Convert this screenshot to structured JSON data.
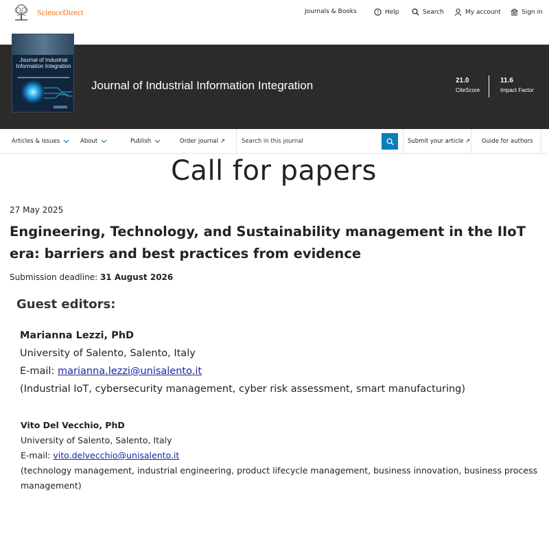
{
  "header": {
    "brand": "ScienceDirect",
    "nav": [
      {
        "label": "Journals & Books",
        "icon": ""
      },
      {
        "label": "Help",
        "icon": "help-icon"
      },
      {
        "label": "Search",
        "icon": "search-icon"
      },
      {
        "label": "My account",
        "icon": "user-icon"
      },
      {
        "label": "Sign in",
        "icon": "institution-icon"
      }
    ],
    "brand_color": "#e9711c"
  },
  "banner": {
    "cover_title": "Journal of Industrial Information Integration",
    "journal_title": "Journal of Industrial Information Integration",
    "metrics": [
      {
        "value": "21.0",
        "label": "CiteScore"
      },
      {
        "value": "11.6",
        "label": "Impact Factor"
      }
    ],
    "background": "#2b2b2b"
  },
  "journal_nav": {
    "articles": "Articles & Issues",
    "about": "About",
    "publish": "Publish",
    "order": "Order journal ↗",
    "search_placeholder": "Search in this journal",
    "submit": "Submit your article ↗",
    "guide": "Guide for authors",
    "accent": "#0c7dbb"
  },
  "content": {
    "heading": "Call for papers",
    "date": "27 May 2025",
    "title": "Engineering, Technology, and Sustainability management in the IIoT era: barriers and best practices from evidence",
    "deadline_label": "Submission deadline: ",
    "deadline_value": "31 August 2026",
    "guest_heading": "Guest editors:",
    "editors": [
      {
        "name": "Marianna Lezzi, PhD",
        "affiliation": "University of Salento, Salento, Italy",
        "email_label": "E-mail: ",
        "email": "marianna.lezzi@unisalento.it",
        "interests": "(Industrial IoT, cybersecurity management, cyber risk assessment, smart manufacturing)"
      },
      {
        "name": "Vito Del Vecchio, PhD",
        "affiliation": "University of Salento, Salento, Italy",
        "email_label": "E-mail: ",
        "email": "vito.delvecchio@unisalento.it",
        "interests": "(technology management, industrial engineering, product lifecycle management, business innovation, business process management)"
      }
    ],
    "link_color": "#1a24a0"
  }
}
